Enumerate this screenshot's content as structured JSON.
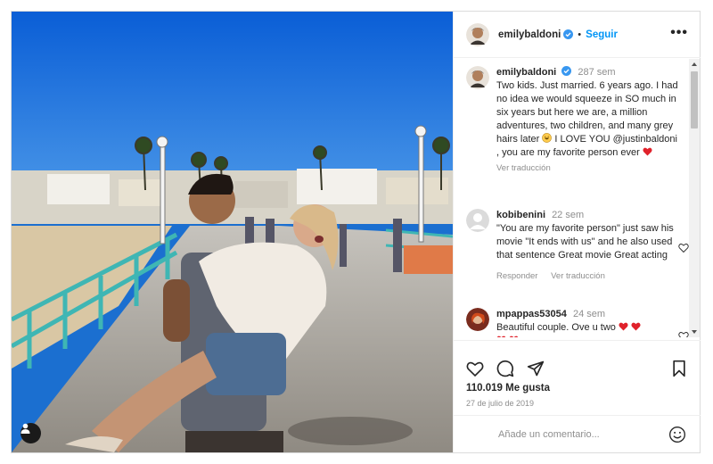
{
  "post": {
    "author": "emilybaldoni",
    "follow_label": "Seguir",
    "more_label": "•••",
    "likes": "110.019 Me gusta",
    "date": "27 de julio de 2019"
  },
  "caption": {
    "user": "emilybaldoni",
    "time": "287 sem",
    "text_part1": "Two kids. Just married. 6 years ago. I had no idea we would squeeze in SO much in six years but here we are, a million adventures, two children, and many grey hairs later",
    "text_part2": "I LOVE YOU @justinbaldoni , you are my favorite person ever",
    "translate": "Ver traducción"
  },
  "comments": [
    {
      "user": "kobibenini",
      "time": "22 sem",
      "text": "\"You are my favorite person\" just saw his movie \"It ends with us\" and he also used that sentence Great movie Great acting",
      "reply": "Responder",
      "translate": "Ver traducción"
    },
    {
      "user": "mpappas53054",
      "time": "24 sem",
      "text": "Beautiful couple. Ove u two"
    }
  ],
  "composer": {
    "placeholder": "Añade un comentario..."
  },
  "icons": {
    "verified": "verified-badge-icon",
    "like": "heart-icon",
    "comment": "comment-icon",
    "share": "paper-plane-icon",
    "save": "bookmark-icon",
    "emoji": "emoji-icon",
    "tag": "user-tag-icon"
  },
  "colors": {
    "link": "#0095f6",
    "verified": "#3897f0",
    "heart": "#ed4956",
    "muted": "#8e8e8e"
  }
}
